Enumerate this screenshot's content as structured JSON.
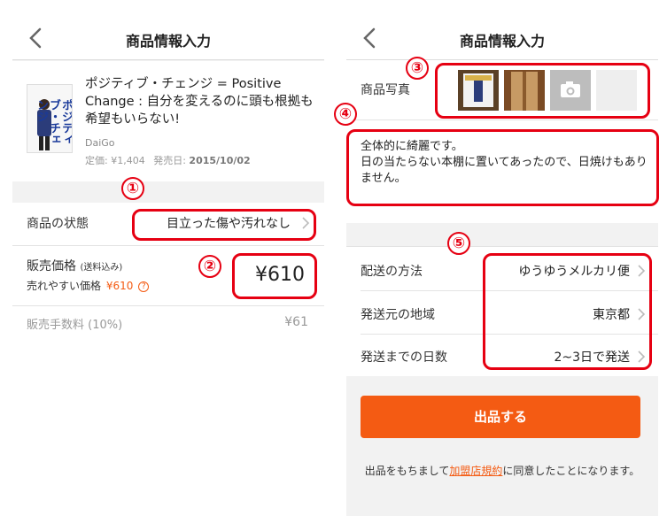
{
  "left": {
    "nav_title": "商品情報入力",
    "product": {
      "title": "ポジティブ・チェンジ = Positive Change : 自分を変えるのに頭も根拠も希望もいらない!",
      "author": "DaiGo",
      "list_price": "定価: ¥1,404",
      "release_label": "発売日:",
      "release_date": "2015/10/02",
      "cover_text": "ポジティブ・チェンジ"
    },
    "condition": {
      "label": "商品の状態",
      "value": "目立った傷や汚れなし"
    },
    "price": {
      "label": "販売価格",
      "shipping_note": "(送料込み)",
      "easy_sell_label": "売れやすい価格",
      "easy_sell_price": "¥610",
      "value": "¥610"
    },
    "fee": {
      "label": "販売手数料 (10%)",
      "value": "¥61"
    },
    "annotations": {
      "a1": "①",
      "a2": "②"
    },
    "colors": {
      "accent": "#f45b13",
      "annotation": "#e60012"
    }
  },
  "right": {
    "nav_title": "商品情報入力",
    "photos_label": "商品写真",
    "description": "全体的に綺麗です。\n日の当たらない本棚に置いてあったので、日焼けもありません。",
    "shipping": [
      {
        "label": "配送の方法",
        "value": "ゆうゆうメルカリ便"
      },
      {
        "label": "発送元の地域",
        "value": "東京都"
      },
      {
        "label": "発送までの日数",
        "value": "2~3日で発送"
      }
    ],
    "submit_label": "出品する",
    "terms": {
      "before": "出品をもちまして",
      "link": "加盟店規約",
      "after": "に同意したことになります。"
    },
    "annotations": {
      "a3": "③",
      "a4": "④",
      "a5": "⑤"
    }
  }
}
